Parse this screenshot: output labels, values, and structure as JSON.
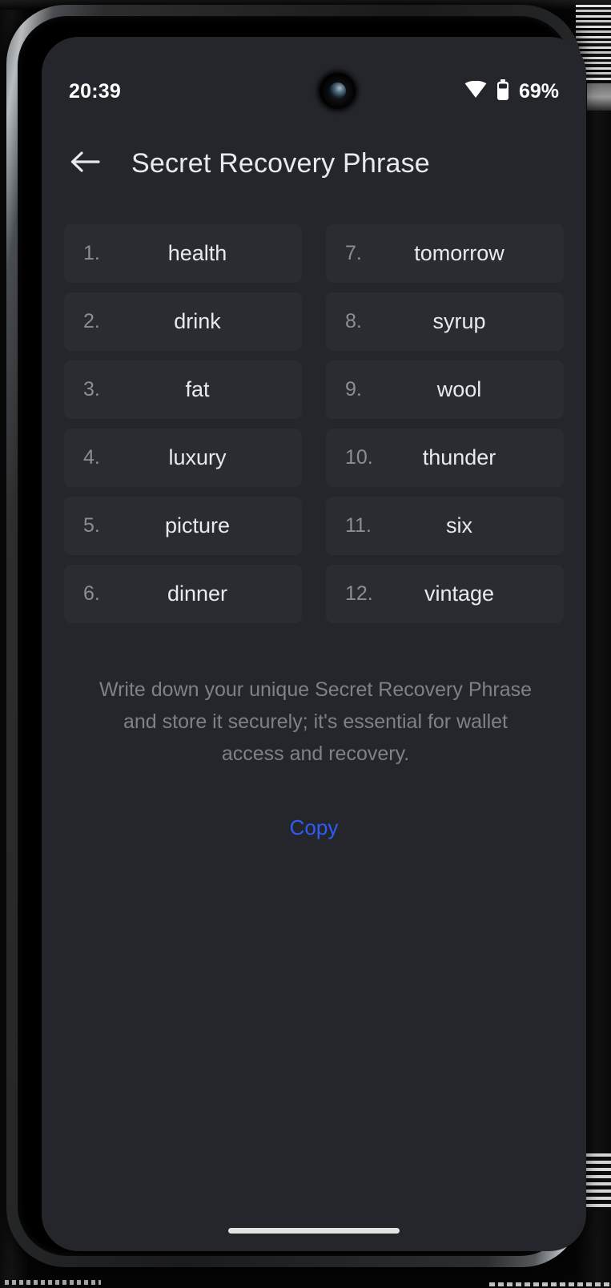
{
  "status_bar": {
    "time": "20:39",
    "wifi_icon": "wifi-icon",
    "battery_icon": "battery-icon",
    "battery_text": "69%"
  },
  "header": {
    "back_icon": "back-arrow-icon",
    "title": "Secret Recovery Phrase"
  },
  "recovery_phrase": {
    "words": [
      {
        "index": "1.",
        "word": "health"
      },
      {
        "index": "7.",
        "word": "tomorrow"
      },
      {
        "index": "2.",
        "word": "drink"
      },
      {
        "index": "8.",
        "word": "syrup"
      },
      {
        "index": "3.",
        "word": "fat"
      },
      {
        "index": "9.",
        "word": "wool"
      },
      {
        "index": "4.",
        "word": "luxury"
      },
      {
        "index": "10.",
        "word": "thunder"
      },
      {
        "index": "5.",
        "word": "picture"
      },
      {
        "index": "11.",
        "word": "six"
      },
      {
        "index": "6.",
        "word": "dinner"
      },
      {
        "index": "12.",
        "word": "vintage"
      }
    ]
  },
  "description": "Write down your unique Secret Recovery Phrase and store it securely; it's essential for wallet access and recovery.",
  "actions": {
    "copy_label": "Copy"
  },
  "colors": {
    "screen_background": "#24262b",
    "card_background": "#2a2c31",
    "primary_text": "#e9eaec",
    "secondary_text": "#7e8287",
    "index_text": "#8b8e93",
    "accent_blue": "#2f5cf7",
    "home_indicator": "#e3e3e1"
  }
}
